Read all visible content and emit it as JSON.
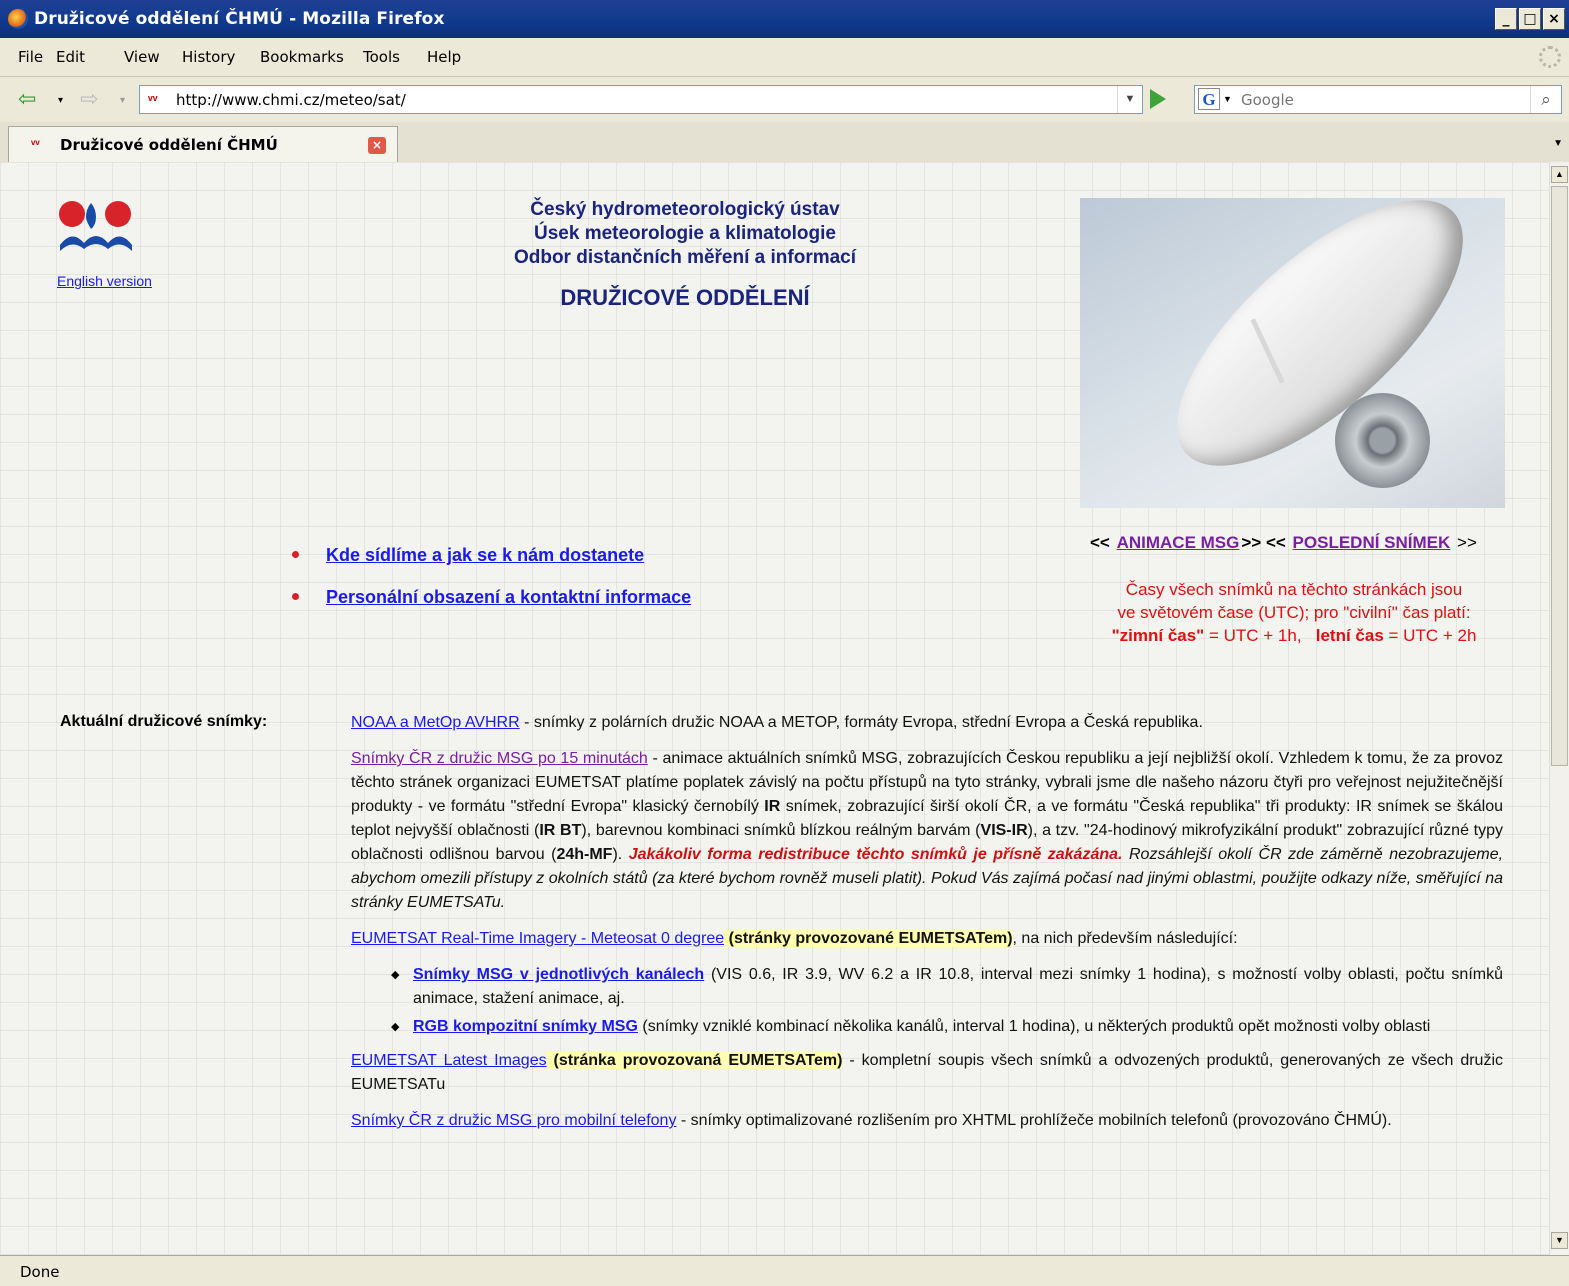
{
  "window": {
    "title": "Družicové oddělení ČHMÚ - Mozilla Firefox",
    "min": "_",
    "max": "□",
    "close": "×"
  },
  "menu": [
    "File",
    "Edit",
    "View",
    "History",
    "Bookmarks",
    "Tools",
    "Help"
  ],
  "nav": {
    "url": "http://www.chmi.cz/meteo/sat/",
    "search_placeholder": "Google",
    "search_engine_letter": "G"
  },
  "tab": {
    "label": "Družicové oddělení ČHMÚ"
  },
  "status": "Done",
  "page": {
    "english_link": "English version",
    "header_lines": [
      "Český hydrometeorologický ústav",
      "Úsek meteorologie a klimatologie",
      "Odbor distančních měření a informací"
    ],
    "department": "DRUŽICOVÉ ODDĚLENÍ",
    "anim_prefix": "<<",
    "anim_link": "ANIMACE MSG",
    "anim_mid": ">>  <<",
    "last_link": "POSLEDNÍ SNÍMEK",
    "anim_suffix": ">>",
    "utc_line1": "Časy všech snímků na těchto stránkách jsou",
    "utc_line2": "ve světovém čase (UTC); pro \"civilní\" čas platí:",
    "utc_winter_label": "\"zimní čas\"",
    "utc_winter_value": " = UTC + 1h,",
    "utc_summer_label": "letní čas",
    "utc_summer_value": " = UTC + 2h",
    "links": [
      "Kde sídlíme a jak se k nám dostanete",
      "Personální obsazení a kontaktní informace"
    ],
    "section_label": "Aktuální družicové snímky:",
    "p1_link": "NOAA a MetOp AVHRR",
    "p1_text": " -  snímky z polárních družic NOAA a METOP, formáty Evropa, střední Evropa a Česká republika.",
    "p2_link": "Snímky ČR z družic MSG po 15 minutách",
    "p2_a": " -  animace aktuálních snímků MSG, zobrazujících Českou republiku a její nejbližší okolí. Vzhledem k tomu, že za provoz těchto stránek organizaci EUMETSAT platíme poplatek závislý na počtu přístupů na tyto stránky, vybrali jsme dle našeho názoru čtyři pro veřejnost nejužitečnější produkty - ve formátu \"střední Evropa\" klasický černobílý ",
    "p2_ir": "IR",
    "p2_b": " snímek, zobrazující širší okolí ČR, a ve formátu \"Česká republika\" tři produkty: IR snímek se škálou teplot nejvyšší oblačnosti (",
    "p2_irbt": "IR BT",
    "p2_c": "), barevnou kombinaci snímků blízkou reálným barvám (",
    "p2_visir": "VIS-IR",
    "p2_d": "), a tzv. \"24-hodinový mikrofyzikální produkt\" zobrazující různé typy oblačnosti odlišnou barvou (",
    "p2_24h": "24h-MF",
    "p2_e": "). ",
    "p2_red": "Jakákoliv forma redistribuce těchto snímků je přísně zakázána.",
    "p2_italic": " Rozsáhlejší okolí ČR zde záměrně nezobrazujeme, abychom omezili přístupy z okolních států (za které bychom rovněž museli platit). Pokud Vás zajímá počasí nad jinými oblastmi, použijte odkazy níže, směřující na stránky EUMETSATu.",
    "p3_link": "EUMETSAT Real-Time Imagery - Meteosat 0 degree",
    "p3_hl": " (stránky provozované EUMETSATem)",
    "p3_text": ", na nich především následující:",
    "li1_link": "Snímky MSG v jednotlivých kanálech",
    "li1_text": " (VIS 0.6, IR 3.9, WV 6.2 a IR 10.8, interval mezi snímky 1 hodina), s možností volby oblasti, počtu snímků animace, stažení animace, aj.",
    "li2_link": "RGB kompozitní snímky MSG",
    "li2_text": " (snímky vzniklé kombinací několika kanálů, interval 1 hodina), u některých produktů opět možnosti volby oblasti",
    "p4_link": "EUMETSAT Latest Images",
    "p4_hl": " (stránka provozovaná EUMETSATem)",
    "p4_text": " - kompletní soupis všech snímků a odvozených produktů, generovaných ze všech družic EUMETSATu",
    "p5_link": "Snímky ČR z družic MSG pro mobilní telefony",
    "p5_text": " -  snímky optimalizované rozlišením pro XHTML prohlížeče mobilních telefonů (provozováno ČHMÚ)."
  }
}
